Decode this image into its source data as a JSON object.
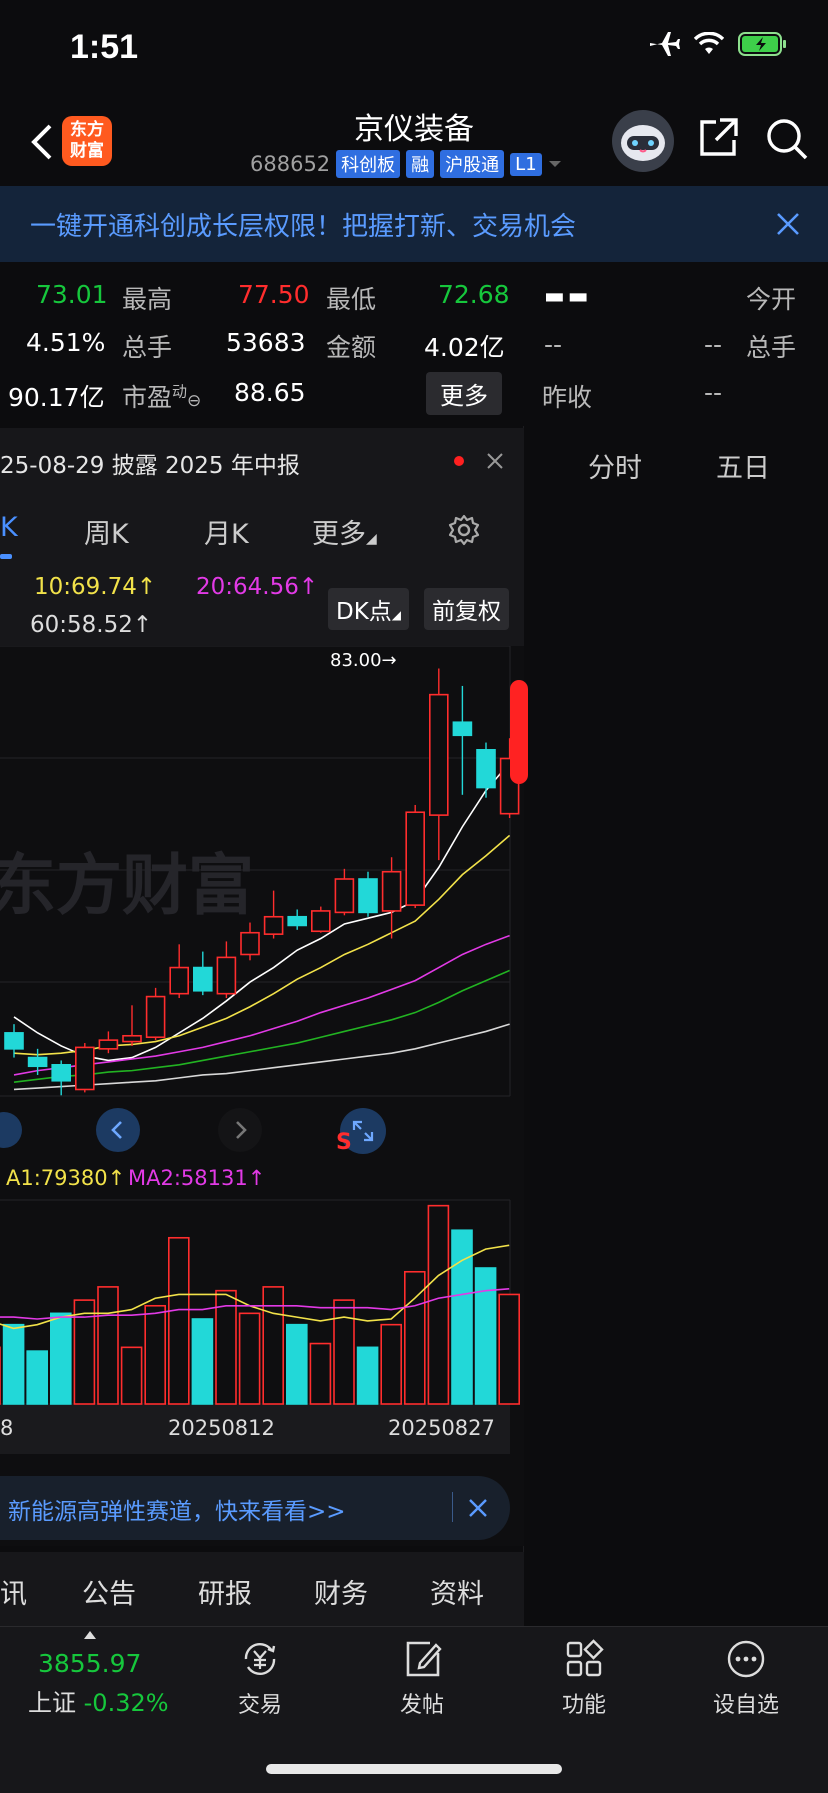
{
  "status": {
    "time": "1:51"
  },
  "header": {
    "stock_name": "京仪装备",
    "code": "688652",
    "tags": [
      "科创板",
      "融",
      "沪股通",
      "L1"
    ],
    "logo_line1": "东方",
    "logo_line2": "财富"
  },
  "banner": {
    "text": "一键开通科创成长层权限！把握打新、交易机会"
  },
  "quote": {
    "price_partial": "73.01",
    "high_label": "最高",
    "high": "77.50",
    "low_label": "最低",
    "low": "72.68",
    "pct": "4.51%",
    "volume_label": "总手",
    "volume": "53683",
    "amount_label": "金额",
    "amount": "4.02亿",
    "mcap": "90.17亿",
    "pe_label": "市盈",
    "pe_sup": "动",
    "pe": "88.65",
    "more": "更多",
    "right_dash": "▬ ▬",
    "open_label": "今开",
    "r_vol_dash1": "--",
    "r_vol_dash2": "--",
    "r_vol_label": "总手",
    "prev_label": "昨收",
    "prev_dash": "--"
  },
  "notice": {
    "text": "25-08-29 披露 2025 年中报"
  },
  "right_tabs": [
    "分时",
    "五日"
  ],
  "period_tabs": {
    "active": "K",
    "weekly": "周K",
    "monthly": "月K",
    "more": "更多"
  },
  "ma": {
    "ma10": "10:69.74↑",
    "ma20": "20:64.56↑",
    "ma60": "60:58.52↑",
    "dk_button": "DK点",
    "adj_button": "前复权"
  },
  "chart": {
    "max_label": "83.00→",
    "watermark": "东方财富",
    "s_marker": "S"
  },
  "volume_ma": {
    "ma1": "A1:79380↑",
    "ma2": "MA2:58131↑"
  },
  "x_axis": {
    "left": "8",
    "mid": "20250812",
    "right": "20250827"
  },
  "ad": {
    "text": "新能源高弹性赛道，快来看看>>"
  },
  "info_tabs": [
    "讯",
    "公告",
    "研报",
    "财务",
    "资料"
  ],
  "bottom_nav": {
    "index_value": "3855.97",
    "index_name": "上证",
    "index_pct": "-0.32%",
    "trade": "交易",
    "post": "发帖",
    "func": "功能",
    "add_fav": "设自选"
  },
  "colors": {
    "up": "#ff2d2d",
    "down": "#22d8d8",
    "green": "#16c73c",
    "accent": "#2f6ee0"
  },
  "chart_data": {
    "type": "candlestick",
    "candles": [
      {
        "o": 57.9,
        "c": 56.8,
        "h": 58.5,
        "l": 56.2
      },
      {
        "o": 56.2,
        "c": 55.6,
        "h": 56.8,
        "l": 55.0
      },
      {
        "o": 55.7,
        "c": 54.6,
        "h": 56.0,
        "l": 53.6
      },
      {
        "o": 54.0,
        "c": 56.9,
        "h": 57.2,
        "l": 53.8
      },
      {
        "o": 56.8,
        "c": 57.4,
        "h": 58.0,
        "l": 56.5
      },
      {
        "o": 57.3,
        "c": 57.7,
        "h": 59.8,
        "l": 57.0
      },
      {
        "o": 57.6,
        "c": 60.4,
        "h": 61.0,
        "l": 57.4
      },
      {
        "o": 60.6,
        "c": 62.4,
        "h": 64.0,
        "l": 60.3
      },
      {
        "o": 62.4,
        "c": 60.8,
        "h": 63.5,
        "l": 60.5
      },
      {
        "o": 60.6,
        "c": 63.1,
        "h": 64.2,
        "l": 60.3
      },
      {
        "o": 63.3,
        "c": 64.8,
        "h": 65.5,
        "l": 62.9
      },
      {
        "o": 64.7,
        "c": 65.9,
        "h": 67.7,
        "l": 64.4
      },
      {
        "o": 65.9,
        "c": 65.3,
        "h": 66.4,
        "l": 65.0
      },
      {
        "o": 64.9,
        "c": 66.3,
        "h": 66.6,
        "l": 64.8
      },
      {
        "o": 66.2,
        "c": 68.5,
        "h": 69.2,
        "l": 66.0
      },
      {
        "o": 68.5,
        "c": 66.2,
        "h": 69.0,
        "l": 65.9
      },
      {
        "o": 66.3,
        "c": 69.0,
        "h": 70.0,
        "l": 64.4
      },
      {
        "o": 66.7,
        "c": 73.1,
        "h": 73.6,
        "l": 66.5
      },
      {
        "o": 72.9,
        "c": 81.2,
        "h": 83.0,
        "l": 69.8
      },
      {
        "o": 79.3,
        "c": 78.4,
        "h": 81.8,
        "l": 74.3
      },
      {
        "o": 77.4,
        "c": 74.8,
        "h": 77.9,
        "l": 74.1
      },
      {
        "o": 73.0,
        "c": 76.8,
        "h": 78.2,
        "l": 72.7
      }
    ],
    "volumes": [
      30,
      42,
      28,
      48,
      55,
      62,
      30,
      52,
      88,
      45,
      60,
      48,
      62,
      42,
      32,
      55,
      30,
      42,
      70,
      105,
      92,
      72,
      58
    ],
    "volume_up": [
      true,
      false,
      false,
      false,
      true,
      true,
      true,
      true,
      true,
      false,
      true,
      true,
      true,
      false,
      true,
      true,
      false,
      true,
      true,
      true,
      false,
      false,
      true
    ],
    "ma_lines": {
      "ma5": [
        59.0,
        57.9,
        57.0,
        56.3,
        56.0,
        56.2,
        56.9,
        57.9,
        58.9,
        60.1,
        61.4,
        62.4,
        63.6,
        64.4,
        65.4,
        65.8,
        66.2,
        67.0,
        69.3,
        72.1,
        74.6,
        76.5
      ],
      "ma10": [
        56.5,
        56.4,
        56.5,
        56.7,
        57.0,
        57.1,
        57.3,
        57.7,
        58.3,
        58.9,
        59.7,
        60.6,
        61.6,
        62.4,
        63.3,
        64.0,
        64.8,
        65.6,
        67.1,
        68.8,
        70.1,
        71.5
      ],
      "ma20": [
        55.0,
        55.3,
        55.5,
        55.7,
        55.9,
        56.1,
        56.3,
        56.6,
        56.9,
        57.3,
        57.7,
        58.2,
        58.7,
        59.3,
        59.8,
        60.3,
        60.9,
        61.5,
        62.4,
        63.3,
        64.0,
        64.6
      ],
      "ma30": [
        54.5,
        54.7,
        54.9,
        55.0,
        55.2,
        55.3,
        55.5,
        55.7,
        56.0,
        56.3,
        56.6,
        56.9,
        57.2,
        57.6,
        58.0,
        58.4,
        58.8,
        59.3,
        60.0,
        60.8,
        61.5,
        62.2
      ],
      "ma60": [
        54.0,
        54.1,
        54.2,
        54.3,
        54.4,
        54.5,
        54.6,
        54.8,
        55.0,
        55.1,
        55.3,
        55.5,
        55.7,
        55.9,
        56.1,
        56.3,
        56.5,
        56.8,
        57.2,
        57.6,
        58.0,
        58.5
      ]
    },
    "vol_ma1": [
      44,
      40,
      42,
      46,
      48,
      48,
      50,
      56,
      58,
      58,
      58,
      52,
      48,
      46,
      44,
      46,
      44,
      45,
      56,
      68,
      76,
      82,
      84
    ],
    "vol_ma2": [
      46,
      46,
      45,
      46,
      46,
      47,
      47,
      48,
      50,
      50,
      52,
      52,
      52,
      52,
      51,
      51,
      51,
      50,
      52,
      56,
      58,
      60,
      61
    ],
    "ylim": [
      53,
      84
    ]
  }
}
